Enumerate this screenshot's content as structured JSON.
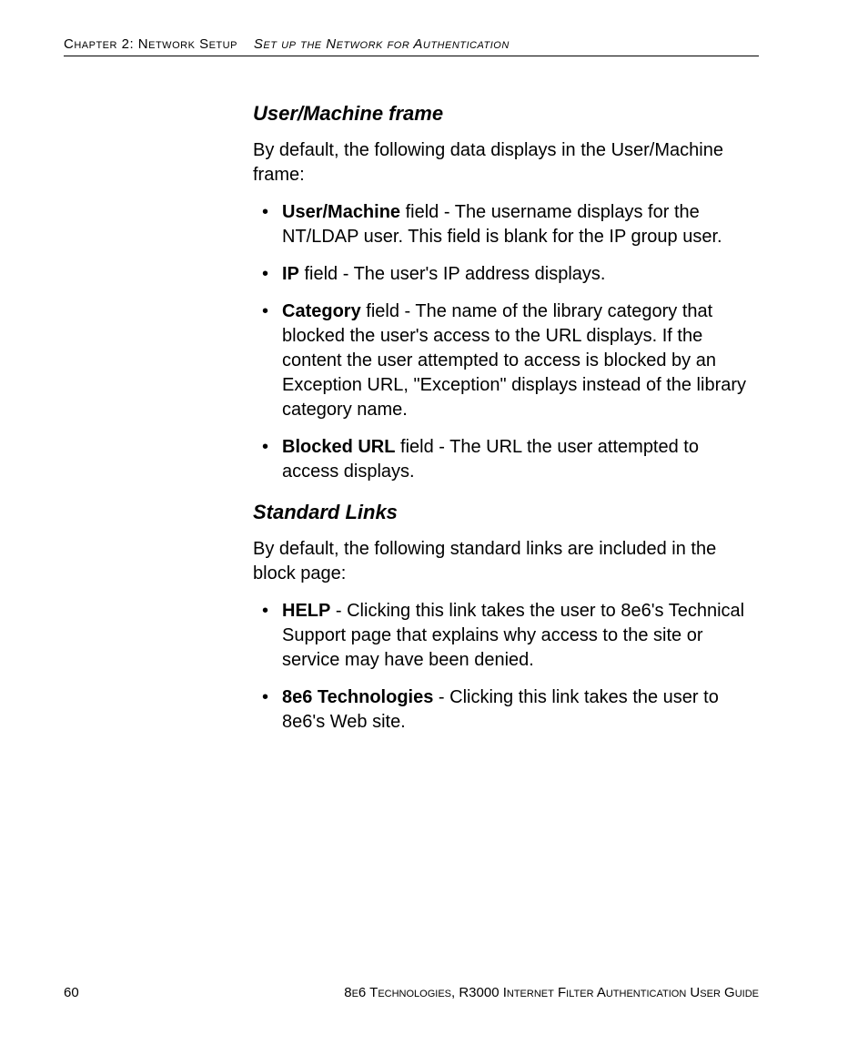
{
  "header": {
    "chapter_label": "Chapter 2: Network Setup",
    "section_label": "Set up the Network for Authentication"
  },
  "section1": {
    "heading": "User/Machine frame",
    "intro": "By default, the following data displays in the User/Machine frame:",
    "items": [
      {
        "bold": "User/Machine",
        "rest": " field - The username displays for the NT/LDAP user. This field is blank for the IP group user."
      },
      {
        "bold": "IP",
        "rest": " field - The user's IP address displays."
      },
      {
        "bold": "Category",
        "rest": " field - The name of the library category that blocked the user's access to the URL displays. If the content the user attempted to access is blocked by an Exception URL, \"Exception\" displays instead of the library category name."
      },
      {
        "bold": "Blocked URL",
        "rest": " field - The URL the user attempted to access displays."
      }
    ]
  },
  "section2": {
    "heading": "Standard Links",
    "intro": "By default, the following standard links are included in the block page:",
    "items": [
      {
        "bold": "HELP",
        "rest": " - Clicking this link takes the user to 8e6's Technical Support page that explains why access to the site or service may have been denied."
      },
      {
        "bold": "8e6 Technologies",
        "rest": " - Clicking this link takes the user to 8e6's Web site."
      }
    ]
  },
  "footer": {
    "page_number": "60",
    "book_title": "8e6 Technologies, R3000 Internet Filter Authentication User Guide"
  }
}
